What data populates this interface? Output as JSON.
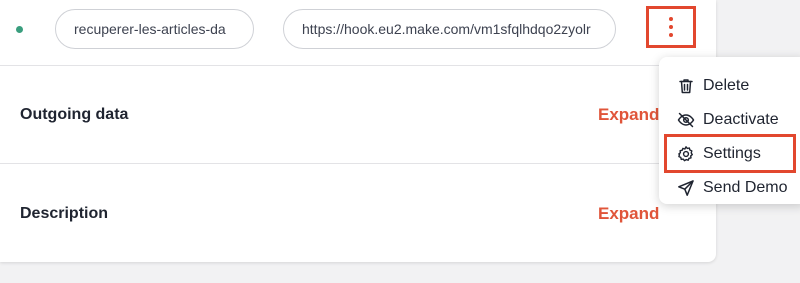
{
  "webhook": {
    "name_value": "recuperer-les-articles-da",
    "url_value": "https://hook.eu2.make.com/vm1sfqlhdqo2zyolr",
    "status_color": "#3a9e7e"
  },
  "sections": [
    {
      "title": "Outgoing data",
      "action": "Expand"
    },
    {
      "title": "Description",
      "action": "Expand"
    }
  ],
  "menu": {
    "items": [
      {
        "label": "Delete",
        "icon": "trash-icon"
      },
      {
        "label": "Deactivate",
        "icon": "eye-off-icon"
      },
      {
        "label": "Settings",
        "icon": "gear-icon"
      },
      {
        "label": "Send Demo",
        "icon": "send-icon"
      }
    ]
  },
  "colors": {
    "accent": "#e0553a",
    "highlight": "#e2472e"
  }
}
